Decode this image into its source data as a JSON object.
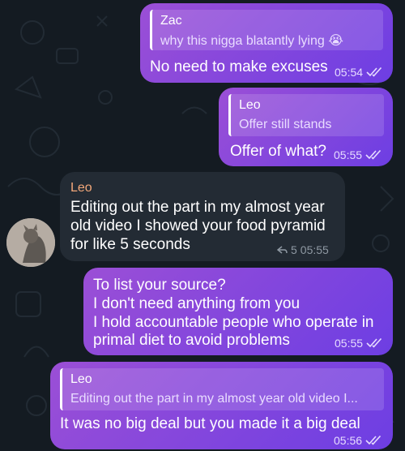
{
  "messages": [
    {
      "reply_name": "Zac",
      "reply_text": "why this nigga blatantly lying 😭",
      "text": "No need to make excuses",
      "time": "05:54"
    },
    {
      "reply_name": "Leo",
      "reply_text": "Offer still stands",
      "text": "Offer of what?",
      "time": "05:55"
    },
    {
      "sender": "Leo",
      "lines": [
        "Editing out the part in my almost year",
        "old video I showed your food pyramid",
        "for like 5 seconds"
      ],
      "replies": "5",
      "time": "05:55"
    },
    {
      "lines": [
        "To list your source?",
        "I don't need anything from you",
        "I hold accountable people who operate in",
        "primal diet to avoid problems"
      ],
      "time": "05:55"
    },
    {
      "reply_name": "Leo",
      "reply_text": "Editing out the part in my almost year old video I...",
      "text": "It was no big deal but you made it a big deal",
      "time": "05:56"
    }
  ],
  "colors": {
    "background": "#141b22",
    "outgoing_start": "#9b4fd6",
    "outgoing_end": "#6d3ee3",
    "incoming": "#232b34",
    "sender_name": "#f3a87a"
  }
}
